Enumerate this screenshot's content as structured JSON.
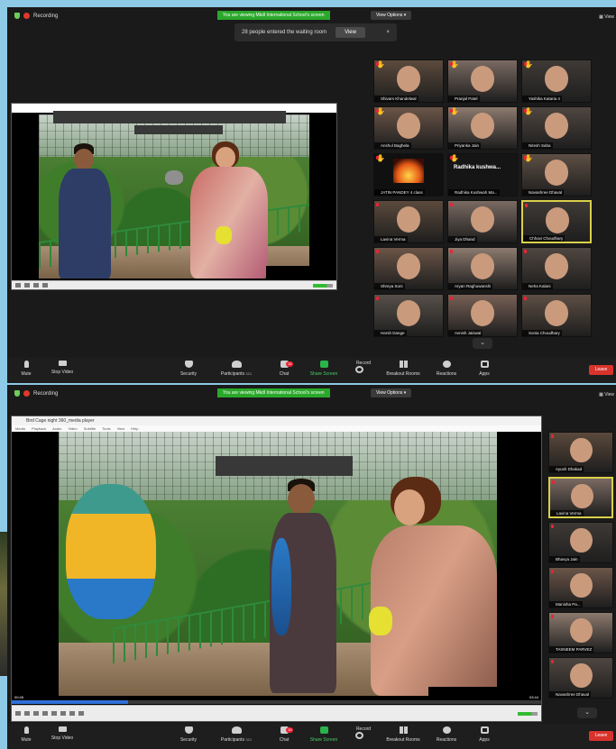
{
  "meeting": {
    "recording_label": "Recording",
    "banner_text": "You are viewing Mkdl International School's screen",
    "view_options_label": "View Options",
    "view_label": "View"
  },
  "shot1": {
    "notification": {
      "text": "28 people entered the waiting room",
      "button": "View",
      "close": "×"
    },
    "participants": [
      {
        "name": "Shivam Khandelwal",
        "hand": true
      },
      {
        "name": "Pranjal Patel",
        "hand": true
      },
      {
        "name": "Yashika Kataria 4",
        "hand": true
      },
      {
        "name": "Anshul Baghela",
        "hand": true
      },
      {
        "name": "Priyanka Jain",
        "hand": true
      },
      {
        "name": "Nitesh Saha",
        "hand": true
      },
      {
        "name": "JATIN PANDEY 4 class",
        "hand": true
      },
      {
        "name": "Radhika Kushwah Ma...",
        "hand": true,
        "tile_text": "Radhika kushwa..."
      },
      {
        "name": "Navashree Dhaval",
        "hand": true
      },
      {
        "name": "Lavina Verma",
        "hand": false
      },
      {
        "name": "Jiya Dhand",
        "hand": false
      },
      {
        "name": "Chhavi Choudhary",
        "hand": false,
        "active": true
      },
      {
        "name": "Shreya Soni",
        "hand": false
      },
      {
        "name": "Aryan Raghuwanshi",
        "hand": false
      },
      {
        "name": "Neha Kalani",
        "hand": false
      },
      {
        "name": "Harsh Dange",
        "hand": false
      },
      {
        "name": "Avnish Jaiswal",
        "hand": false
      },
      {
        "name": "Sonia Choudhary",
        "hand": false
      }
    ],
    "toolbar": {
      "mute": "Mute",
      "stop_video": "Stop Video",
      "security": "Security",
      "participants": "Participants",
      "participants_count": "321",
      "chat": "Chat",
      "chat_badge": "10",
      "share": "Share Screen",
      "record": "Record",
      "rooms": "Breakout Rooms",
      "reactions": "Reactions",
      "apps": "Apps",
      "leave": "Leave"
    }
  },
  "shot2": {
    "player_title": "Bird Cage night 360_media player",
    "player_menu": "Media Playback Audio Video Subtitle Tools View Help",
    "time_elapsed": "00:45",
    "time_total": "03:44",
    "progress": 0.22,
    "participants": [
      {
        "name": "Ayush Dhakad"
      },
      {
        "name": "Lavina Verma",
        "active": true
      },
      {
        "name": "Bhavya Jain"
      },
      {
        "name": "Manisha Pa..."
      },
      {
        "name": "TASNEEM PARVEZ"
      },
      {
        "name": "Navashree Dhaval"
      }
    ],
    "toolbar": {
      "mute": "Mute",
      "stop_video": "Stop Video",
      "security": "Security",
      "participants": "Participants",
      "participants_count": "321",
      "chat": "Chat",
      "chat_badge": "10",
      "share": "Share Screen",
      "record": "Record",
      "rooms": "Breakout Rooms",
      "reactions": "Reactions",
      "apps": "Apps",
      "leave": "Leave"
    }
  },
  "colors": {
    "banner_green": "#2aa82a",
    "leave_red": "#d8332d",
    "share_green": "#2ab34a",
    "active_tile": "#d9d04a",
    "page_bg": "#8ec9e6"
  }
}
